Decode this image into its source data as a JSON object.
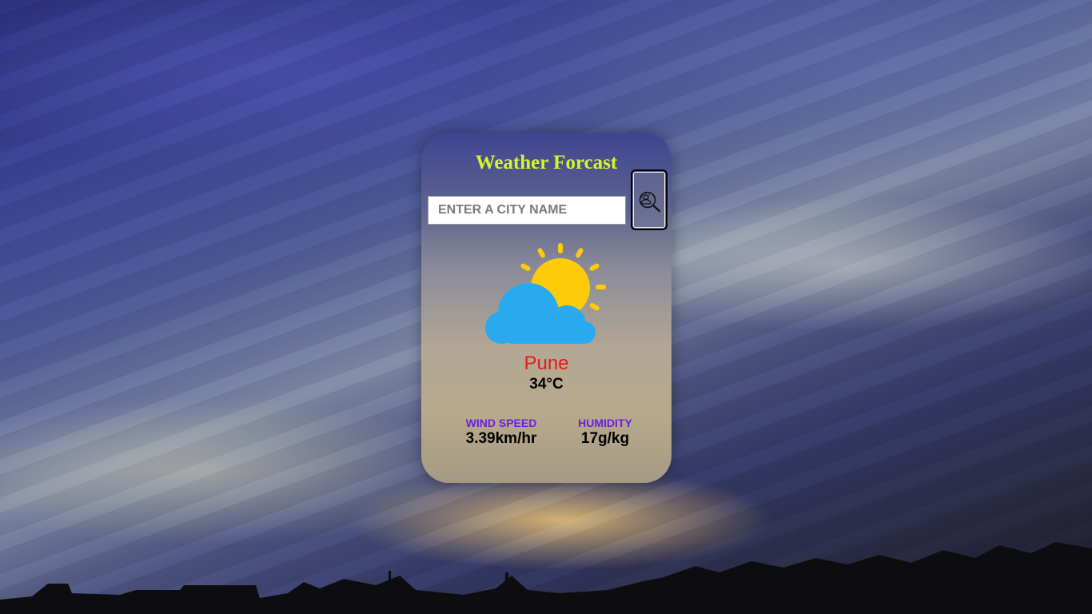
{
  "app": {
    "title": "Weather Forcast"
  },
  "search": {
    "placeholder": "ENTER A CITY NAME",
    "value": "",
    "button_icon": "weather-search-icon"
  },
  "current": {
    "condition_icon": "partly-cloudy-icon",
    "city": "Pune",
    "temperature": "34°C"
  },
  "stats": {
    "wind_label": "WIND SPEED",
    "wind_value": "3.39km/hr",
    "humidity_label": "HUMIDITY",
    "humidity_value": "17g/kg"
  },
  "colors": {
    "title": "#d4f52a",
    "city": "#e31b1b",
    "stat_label": "#6a1fe0",
    "sun": "#fdcb0a",
    "cloud": "#29aaf0"
  }
}
